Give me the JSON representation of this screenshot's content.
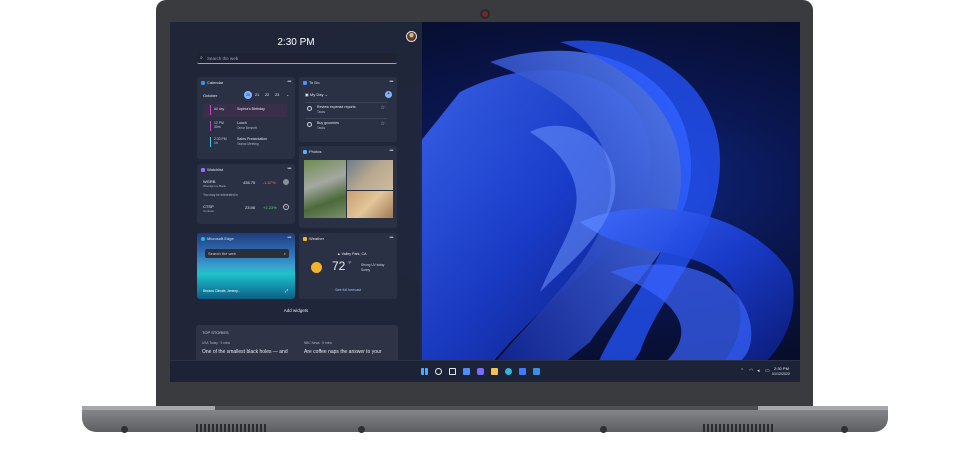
{
  "panel": {
    "clock": "2:30 PM",
    "search_placeholder": "Search the web",
    "add_widgets": "Add widgets"
  },
  "calendar": {
    "title": "Calendar",
    "month": "October",
    "days": [
      "20",
      "21",
      "22",
      "23"
    ],
    "events": [
      {
        "time": "All day",
        "title": "Sophia's Birthday",
        "sub": "",
        "color": "#c24bbf"
      },
      {
        "time": "12 PM\n30m",
        "title": "Lunch",
        "sub": "Omar Bennett",
        "color": "#c24bbf"
      },
      {
        "time": "2:30 PM\n1h",
        "title": "Sales Presentation",
        "sub": "Teams Meeting",
        "color": "#4fc3d6"
      }
    ]
  },
  "todo": {
    "title": "To Do",
    "list": "My Day",
    "items": [
      {
        "title": "Review expense reports",
        "sub": "Tasks"
      },
      {
        "title": "Buy groceries",
        "sub": "Tasks"
      }
    ]
  },
  "watchlist": {
    "title": "Watchlist",
    "stocks": [
      {
        "symbol": "WGRB",
        "name": "Woodgrove Bank",
        "price": "435.75",
        "change": "-1.67%",
        "change_color": "#ff6b6b"
      },
      {
        "symbol": "CTSP",
        "name": "Contoso",
        "price": "23.98",
        "change": "+2.23%",
        "change_color": "#5fd17c"
      }
    ],
    "hint": "You may be interested in"
  },
  "photos": {
    "title": "Photos"
  },
  "edge": {
    "title": "Microsoft Edge",
    "search_placeholder": "Search the web",
    "caption": "Bezana Climate, Jeremy..."
  },
  "weather": {
    "title": "Weather",
    "location": "Valley Park, CA",
    "temp": "72",
    "unit": "°F",
    "detail1": "Strong UV today",
    "detail2": "Sunny",
    "link": "See full forecast"
  },
  "stories": {
    "heading": "TOP STORIES",
    "items": [
      {
        "source": "USA Today · 3 mins",
        "headline": "One of the smallest black holes — and"
      },
      {
        "source": "NBC News · 5 mins",
        "headline": "Are coffee naps the answer to your"
      }
    ]
  },
  "taskbar": {
    "time": "2:30 PM",
    "date": "01/12/2022",
    "icons": [
      "windows-start-icon",
      "search-icon",
      "task-view-icon",
      "widgets-icon",
      "chat-icon",
      "file-explorer-icon",
      "edge-browser-icon",
      "store-icon",
      "mail-icon"
    ]
  },
  "colors": {
    "accent": "#4f8cff",
    "panel_bg": "#22283a",
    "taskbar_bg": "#1d2336"
  }
}
